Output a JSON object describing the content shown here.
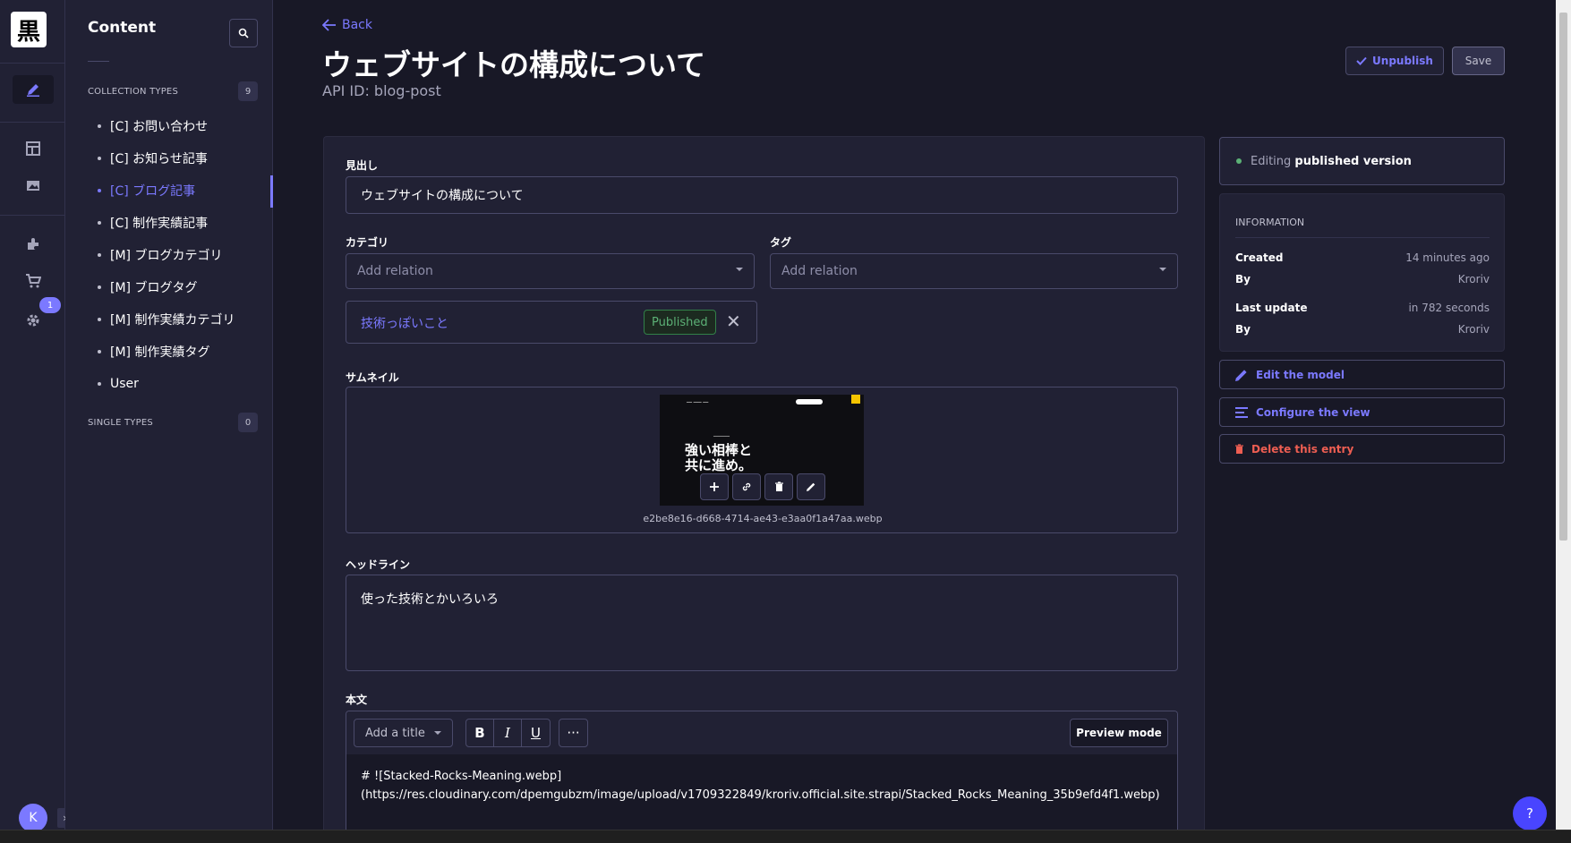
{
  "rail": {
    "logo": "黒",
    "badge": "1",
    "avatar": "K",
    "collapse": "›"
  },
  "content_nav": {
    "title": "Content",
    "collection_types": {
      "label": "COLLECTION TYPES",
      "count": "9",
      "items": [
        {
          "label": "[C] お問い合わせ"
        },
        {
          "label": "[C] お知らせ記事"
        },
        {
          "label": "[C] ブログ記事"
        },
        {
          "label": "[C] 制作実績記事"
        },
        {
          "label": "[M] ブログカテゴリ"
        },
        {
          "label": "[M] ブログタグ"
        },
        {
          "label": "[M] 制作実績カテゴリ"
        },
        {
          "label": "[M] 制作実績タグ"
        },
        {
          "label": "User"
        }
      ]
    },
    "single_types": {
      "label": "SINGLE TYPES",
      "count": "0"
    }
  },
  "header": {
    "back": "Back",
    "title": "ウェブサイトの構成について",
    "api_id": "API ID: blog-post",
    "unpublish": "Unpublish",
    "save": "Save"
  },
  "form": {
    "midashi": {
      "label": "見出し",
      "value": "ウェブサイトの構成について"
    },
    "category": {
      "label": "カテゴリ",
      "placeholder": "Add relation"
    },
    "tag": {
      "label": "タグ",
      "placeholder": "Add relation"
    },
    "relation_item": {
      "name": "技術っぽいこと",
      "status": "Published",
      "remove": "✕"
    },
    "thumbnail": {
      "label": "サムネイル",
      "preview_line1": "強い相棒と",
      "preview_line2": "共に進め。",
      "filename": "e2be8e16-d668-4714-ae43-e3aa0f1a47aa.webp"
    },
    "headline": {
      "label": "ヘッドライン",
      "value": "使った技術とかいろいろ"
    },
    "body": {
      "label": "本文",
      "add_title": "Add a title",
      "bold": "B",
      "italic": "I",
      "underline": "U",
      "more": "···",
      "preview_mode": "Preview mode",
      "line1": "# ![Stacked-Rocks-Meaning.webp]",
      "line2": "(https://res.cloudinary.com/dpemgubzm/image/upload/v1709322849/kroriv.official.site.strapi/Stacked_Rocks_Meaning_35b9efd4f1.webp)"
    }
  },
  "panel": {
    "status_prefix": "Editing ",
    "status_bold": "published version",
    "info_heading": "INFORMATION",
    "created_label": "Created",
    "created_value": "14 minutes ago",
    "by_label": "By",
    "created_by": "Kroriv",
    "updated_label": "Last update",
    "updated_value": "in 782 seconds",
    "updated_by": "Kroriv",
    "edit_model": "Edit the model",
    "configure_view": "Configure the view",
    "delete_entry": "Delete this entry"
  },
  "help": "?",
  "colors": {
    "accent": "#7b79ff",
    "success": "#5cb176",
    "danger": "#ee5e52",
    "background": "#181826",
    "surface": "#212134"
  }
}
